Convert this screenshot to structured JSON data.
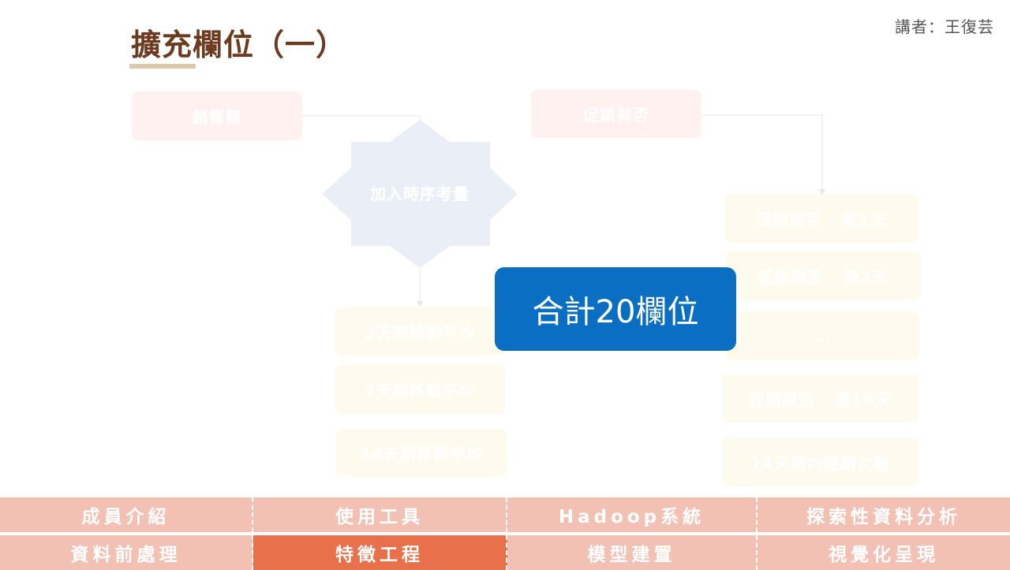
{
  "header": {
    "title": "擴充欄位（一）",
    "speaker": "講者：王復芸"
  },
  "diagram": {
    "sales_box": "銷售額",
    "promo_box": "促銷與否",
    "star_label": "加入時序考量",
    "moving_avg": [
      "3天期移動平均",
      "7天期移動平均",
      "14天期移動平均"
    ],
    "promo_days": [
      "促銷與否 - 第1天",
      "促銷與否 - 第2天",
      "…",
      "促銷與否 - 第16天",
      "14天期內促銷次數"
    ],
    "total": "合計20欄位"
  },
  "nav": {
    "row1": [
      "成員介紹",
      "使用工具",
      "Hadoop系統",
      "探索性資料分析"
    ],
    "row2": [
      "資料前處理",
      "特徵工程",
      "模型建置",
      "視覺化呈現"
    ],
    "active": "特徵工程",
    "colors": {
      "inactive": "#f3c1b4",
      "active": "#e8704a"
    }
  }
}
